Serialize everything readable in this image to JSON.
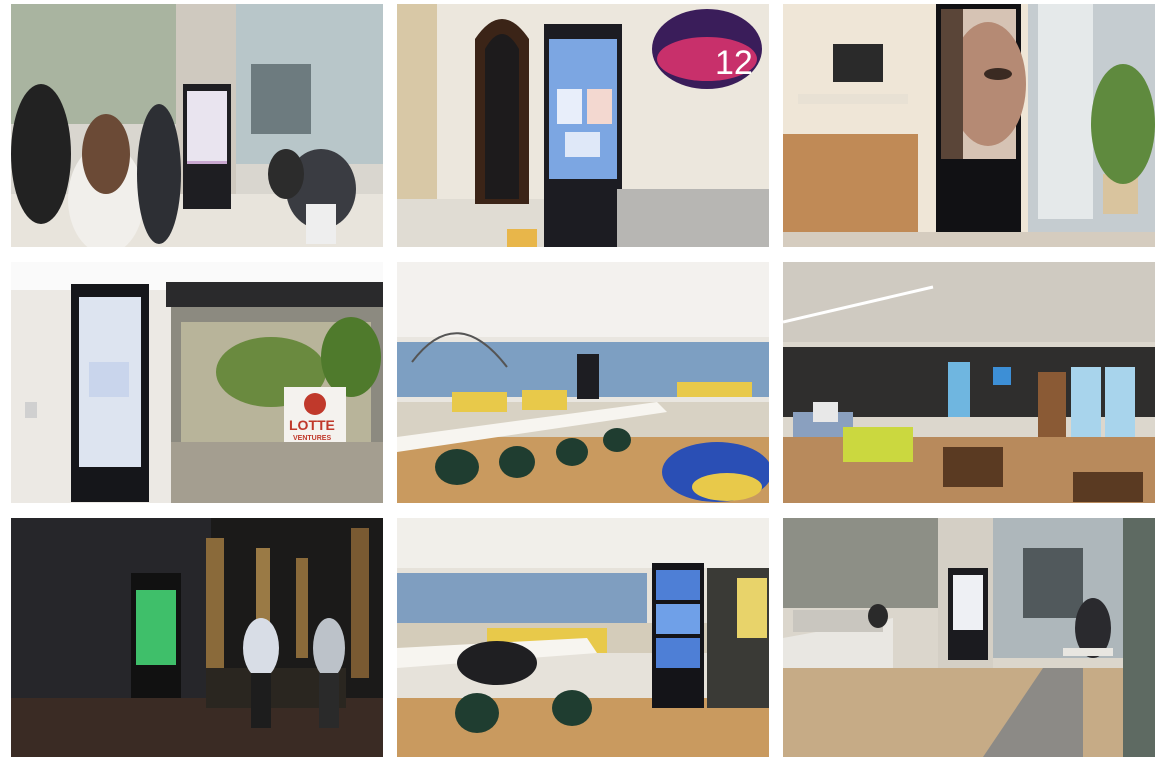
{
  "photos": [
    {
      "subject": "cafe with digital signage kiosk near windows"
    },
    {
      "subject": "lobby with digital signage kiosk and arched doorway"
    },
    {
      "subject": "digital signage kiosk showing face near window"
    },
    {
      "subject": "glass entrance with wall-mounted display",
      "sign_text": "LOTTE",
      "sign_subtext": "VENTURES"
    },
    {
      "subject": "coworking lounge with long tables and yellow seating"
    },
    {
      "subject": "cafe lounge with fridges and green sofa"
    },
    {
      "subject": "dark hallway with green-screen kiosk and two people"
    },
    {
      "subject": "coworking lounge with multi-screen kiosk"
    },
    {
      "subject": "cafe counter with kiosk by windows"
    }
  ],
  "panel_number": "12",
  "colors": {
    "border": "#ffffff",
    "screen_blue": "#5b8fd9",
    "screen_green": "#3fbf6a",
    "wood": "#c99a5f",
    "yellow": "#e8c94a"
  }
}
